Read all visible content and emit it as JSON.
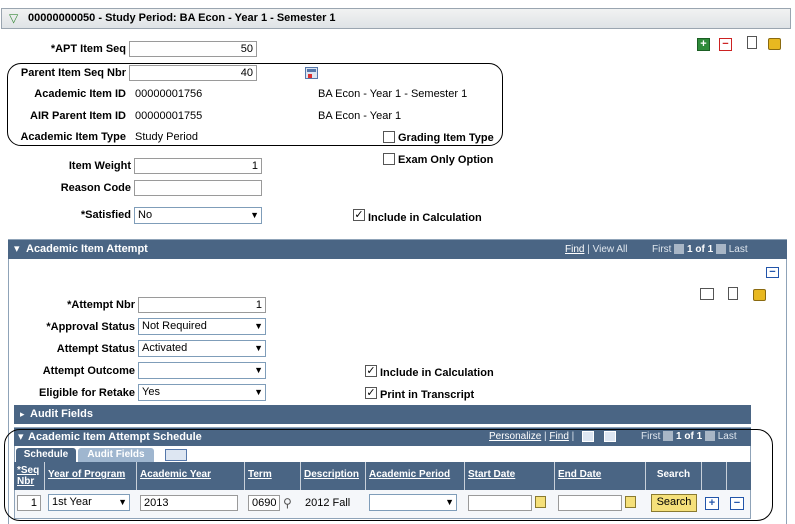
{
  "header": {
    "title": "00000000050 - Study Period: BA Econ - Year 1 - Semester 1"
  },
  "item": {
    "apt_seq_label": "*APT Item Seq",
    "apt_seq_value": "50",
    "parent_seq_label": "Parent Item Seq Nbr",
    "parent_seq_value": "40",
    "acad_item_id_label": "Academic Item ID",
    "acad_item_id_value": "00000001756",
    "acad_item_id_desc": "BA Econ - Year 1 - Semester 1",
    "air_parent_label": "AIR Parent Item ID",
    "air_parent_value": "00000001755",
    "air_parent_desc": "BA Econ - Year 1",
    "item_type_label": "Academic Item Type",
    "item_type_value": "Study Period",
    "grading_label": "Grading Item Type",
    "exam_only_label": "Exam Only Option",
    "weight_label": "Item Weight",
    "weight_value": "1",
    "reason_label": "Reason Code",
    "reason_value": "",
    "satisfied_label": "*Satisfied",
    "satisfied_value": "No",
    "include_calc_label": "Include in Calculation"
  },
  "attempt": {
    "title": "Academic Item Attempt",
    "nav": {
      "find": "Find",
      "view_all": "View All",
      "first": "First",
      "range": "1 of 1",
      "last": "Last"
    },
    "attempt_nbr_label": "*Attempt Nbr",
    "attempt_nbr_value": "1",
    "approval_label": "*Approval Status",
    "approval_value": "Not Required",
    "status_label": "Attempt Status",
    "status_value": "Activated",
    "outcome_label": "Attempt Outcome",
    "outcome_value": "",
    "retake_label": "Eligible for Retake",
    "retake_value": "Yes",
    "include_calc_label": "Include in Calculation",
    "print_transcript_label": "Print in Transcript",
    "audit_title": "Audit Fields"
  },
  "schedule": {
    "title": "Academic Item Attempt Schedule",
    "nav": {
      "personalize": "Personalize",
      "find": "Find",
      "first": "First",
      "range": "1 of 1",
      "last": "Last"
    },
    "tabs": [
      "Schedule",
      "Audit Fields"
    ],
    "columns": [
      "*Seq Nbr",
      "Year of Program",
      "Academic Year",
      "Term",
      "Description",
      "Academic Period",
      "Start Date",
      "End Date",
      "Search"
    ],
    "row": {
      "seq": "1",
      "year_of_program": "1st Year",
      "academic_year": "2013",
      "term": "0690",
      "description": "2012 Fall",
      "academic_period": "",
      "start_date": "",
      "end_date": "",
      "search_label": "Search"
    }
  }
}
